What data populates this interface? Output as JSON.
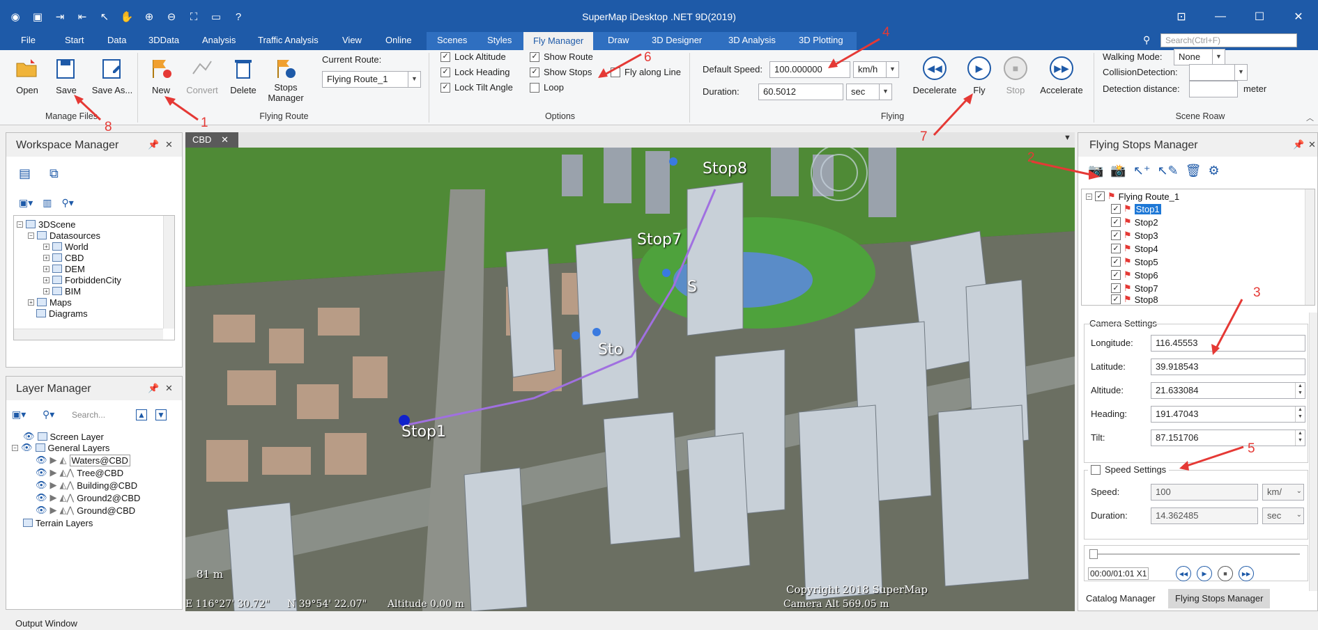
{
  "window": {
    "title": "SuperMap iDesktop .NET 9D(2019)"
  },
  "quick_access": [
    "app-icon",
    "save-icon",
    "import-icon",
    "export-icon",
    "select-icon",
    "pan-icon",
    "zoom-in-icon",
    "zoom-out-icon",
    "full-extent-icon",
    "open-folder-icon",
    "help-icon"
  ],
  "menu": {
    "items": [
      "File",
      "Start",
      "Data",
      "3DData",
      "Analysis",
      "Traffic Analysis",
      "View",
      "Online",
      "Scenes",
      "Styles",
      "Fly Manager",
      "Draw",
      "3D Designer",
      "3D Analysis",
      "3D Plotting"
    ],
    "active": "Fly Manager",
    "search_placeholder": "Search(Ctrl+F)"
  },
  "ribbon": {
    "manage_files": {
      "label": "Manage Files",
      "open": "Open",
      "save": "Save",
      "save_as": "Save As..."
    },
    "flying_route": {
      "label": "Flying Route",
      "new": "New",
      "convert": "Convert",
      "delete": "Delete",
      "stops_manager_1": "Stops",
      "stops_manager_2": "Manager",
      "current_route_label": "Current Route:",
      "current_route": "Flying Route_1"
    },
    "options": {
      "label": "Options",
      "lock_altitude": "Lock Altitude",
      "lock_heading": "Lock Heading",
      "lock_tilt_angle": "Lock Tilt Angle",
      "show_route": "Show Route",
      "show_stops": "Show Stops",
      "loop": "Loop",
      "fly_along_line": "Fly along Line"
    },
    "flying": {
      "label": "Flying",
      "default_speed_label": "Default Speed:",
      "default_speed": "100.000000",
      "speed_unit": "km/h",
      "duration_label": "Duration:",
      "duration": "60.5012",
      "duration_unit": "sec",
      "decelerate": "Decelerate",
      "fly": "Fly",
      "stop": "Stop",
      "accelerate": "Accelerate"
    },
    "scene_roaw": {
      "label": "Scene Roaw",
      "walking_mode_label": "Walking Mode:",
      "walking_mode": "None",
      "collision_label": "CollisionDetection:",
      "detection_distance_label": "Detection distance:",
      "meter": "meter"
    }
  },
  "workspace_manager": {
    "title": "Workspace Manager",
    "tree": [
      "3DScene",
      "Datasources",
      "World",
      "CBD",
      "DEM",
      "ForbiddenCity",
      "BIM",
      "Maps",
      "Diagrams"
    ]
  },
  "layer_manager": {
    "title": "Layer Manager",
    "search_placeholder": "Search...",
    "tree": [
      "Screen Layer",
      "General Layers",
      "Waters@CBD",
      "Tree@CBD",
      "Building@CBD",
      "Ground2@CBD",
      "Ground@CBD",
      "Terrain Layers"
    ]
  },
  "scene": {
    "tab": "CBD",
    "stops": [
      "Stop8",
      "Stop7",
      "Stop1",
      "Sto",
      "S"
    ],
    "scale": "81 m",
    "copyright": "Copyright 2018 SuperMap",
    "status_lon": "E  116°27' 30.72\"",
    "status_lat": "N  39°54' 22.07\"",
    "status_alt": "Altitude  0.00 m",
    "camera_alt": "Camera Alt  569.05 m"
  },
  "flying_stops_manager": {
    "title": "Flying Stops Manager",
    "route": "Flying Route_1",
    "stops": [
      "Stop1",
      "Stop2",
      "Stop3",
      "Stop4",
      "Stop5",
      "Stop6",
      "Stop7",
      "Stop8"
    ],
    "camera_settings": "Camera Settings",
    "longitude_label": "Longitude:",
    "longitude": "116.45553",
    "latitude_label": "Latitude:",
    "latitude": "39.918543",
    "altitude_label": "Altitude:",
    "altitude": "21.633084",
    "heading_label": "Heading:",
    "heading": "191.47043",
    "tilt_label": "Tilt:",
    "tilt": "87.151706",
    "speed_settings": "Speed Settings",
    "speed_label": "Speed:",
    "speed": "100",
    "speed_unit": "km/",
    "duration_label": "Duration:",
    "duration": "14.362485",
    "duration_unit": "sec",
    "time": "00:00/01:01 X1"
  },
  "bottom_tabs": {
    "catalog": "Catalog Manager",
    "flying": "Flying Stops Manager"
  },
  "output": "Output Window",
  "annotations": [
    "1",
    "2",
    "3",
    "4",
    "5",
    "6",
    "7",
    "8"
  ]
}
